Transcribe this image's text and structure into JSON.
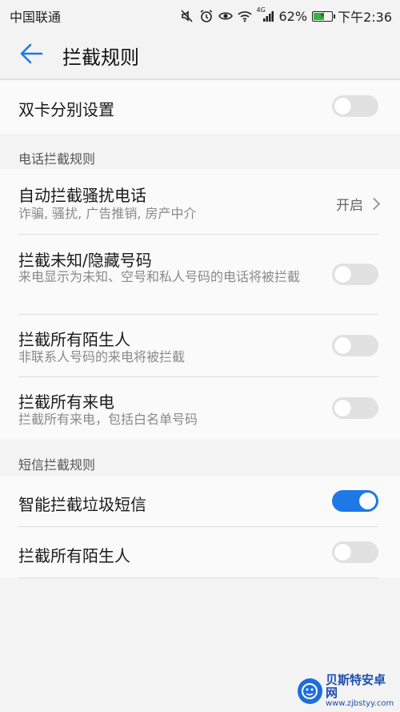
{
  "status_bar": {
    "carrier": "中国联通",
    "network": "4G",
    "battery_percent": "62%",
    "battery_level": 0.62,
    "time": "下午2:36",
    "icons": [
      "mute-icon",
      "alarm-icon",
      "eye-icon",
      "wifi-icon",
      "signal-icon",
      "battery-icon"
    ]
  },
  "app_bar": {
    "title": "拦截规则",
    "back_icon": "arrow-left-icon"
  },
  "dual_sim": {
    "title": "双卡分别设置",
    "enabled": false
  },
  "call_section": {
    "header": "电话拦截规则",
    "items": [
      {
        "title": "自动拦截骚扰电话",
        "subtitle": "诈骗, 骚扰, 广告推销, 房产中介",
        "value": "开启"
      },
      {
        "title": "拦截未知/隐藏号码",
        "subtitle": "来电显示为未知、空号和私人号码的电话将被拦截",
        "enabled": false
      },
      {
        "title": "拦截所有陌生人",
        "subtitle": "非联系人号码的来电将被拦截",
        "enabled": false
      },
      {
        "title": "拦截所有来电",
        "subtitle": "拦截所有来电，包括白名单号码",
        "enabled": false
      }
    ]
  },
  "sms_section": {
    "header": "短信拦截规则",
    "items": [
      {
        "title": "智能拦截垃圾短信",
        "enabled": true
      },
      {
        "title": "拦截所有陌生人",
        "enabled": false
      }
    ]
  },
  "watermark": {
    "name": "贝斯特安卓网",
    "url": "www.zjbstyy.com"
  },
  "colors": {
    "accent": "#1d79e6",
    "toggle_off": "#e1e1e1",
    "background": "#f3f3f3"
  }
}
